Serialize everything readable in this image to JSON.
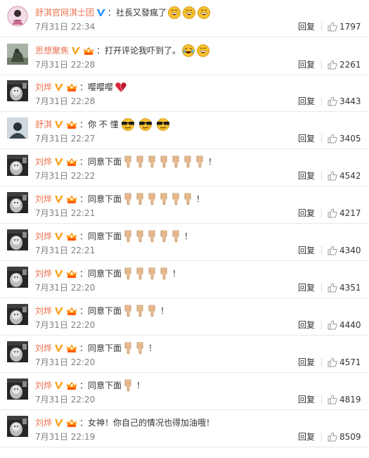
{
  "labels": {
    "reply": "回复",
    "colon": "："
  },
  "colors": {
    "username": "#eb7350",
    "verified_blue": "#1e90ff",
    "verified_orange": "#f7a21b",
    "time": "#808080"
  },
  "comments": [
    {
      "user": "舒淇官网淇士团",
      "verified": "blue",
      "badge": false,
      "text": "社長又發瘋了",
      "emoji": "grin",
      "emoji_count": 3,
      "tail": "",
      "time": "7月31日 22:34",
      "likes": "1797",
      "avatar": "girl"
    },
    {
      "user": "思想聚焦",
      "verified": "orange",
      "badge": true,
      "text": "打开评论我吓到了。",
      "emoji": "laugh-cry-grin",
      "emoji_count": 2,
      "tail": "",
      "time": "7月31日 22:28",
      "likes": "2261",
      "avatar": "statue"
    },
    {
      "user": "刘烨",
      "verified": "orange",
      "badge": true,
      "text": "嘤嘤嘤",
      "emoji": "broken-heart",
      "emoji_count": 1,
      "tail": "",
      "time": "7月31日 22:28",
      "likes": "3443",
      "avatar": "bw"
    },
    {
      "user": "舒淇",
      "verified": "orange",
      "badge": true,
      "text": "你 不 懂",
      "emoji": "sunglasses",
      "emoji_count": 3,
      "tail": "",
      "time": "7月31日 22:27",
      "likes": "3405",
      "avatar": "dark"
    },
    {
      "user": "刘烨",
      "verified": "orange",
      "badge": true,
      "text": "同意下面",
      "emoji": "point-down",
      "emoji_count": 7,
      "tail": "！",
      "time": "7月31日 22:22",
      "likes": "4542",
      "avatar": "bw"
    },
    {
      "user": "刘烨",
      "verified": "orange",
      "badge": true,
      "text": "同意下面",
      "emoji": "point-down",
      "emoji_count": 6,
      "tail": "！",
      "time": "7月31日 22:21",
      "likes": "4217",
      "avatar": "bw"
    },
    {
      "user": "刘烨",
      "verified": "orange",
      "badge": true,
      "text": "同意下面",
      "emoji": "point-down",
      "emoji_count": 5,
      "tail": "！",
      "time": "7月31日 22:21",
      "likes": "4340",
      "avatar": "bw"
    },
    {
      "user": "刘烨",
      "verified": "orange",
      "badge": true,
      "text": "同意下面",
      "emoji": "point-down",
      "emoji_count": 4,
      "tail": "！",
      "time": "7月31日 22:20",
      "likes": "4351",
      "avatar": "bw"
    },
    {
      "user": "刘烨",
      "verified": "orange",
      "badge": true,
      "text": "同意下面",
      "emoji": "point-down",
      "emoji_count": 3,
      "tail": "！",
      "time": "7月31日 22:20",
      "likes": "4440",
      "avatar": "bw"
    },
    {
      "user": "刘烨",
      "verified": "orange",
      "badge": true,
      "text": "同意下面",
      "emoji": "point-down",
      "emoji_count": 2,
      "tail": "！",
      "time": "7月31日 22:20",
      "likes": "4571",
      "avatar": "bw"
    },
    {
      "user": "刘烨",
      "verified": "orange",
      "badge": true,
      "text": "同意下面",
      "emoji": "point-down",
      "emoji_count": 1,
      "tail": "！",
      "time": "7月31日 22:20",
      "likes": "4819",
      "avatar": "bw"
    },
    {
      "user": "刘烨",
      "verified": "orange",
      "badge": true,
      "text": "女神！你自己的情况也得加油哦！",
      "emoji": "",
      "emoji_count": 0,
      "tail": "",
      "time": "7月31日 22:19",
      "likes": "8509",
      "avatar": "bw"
    }
  ]
}
